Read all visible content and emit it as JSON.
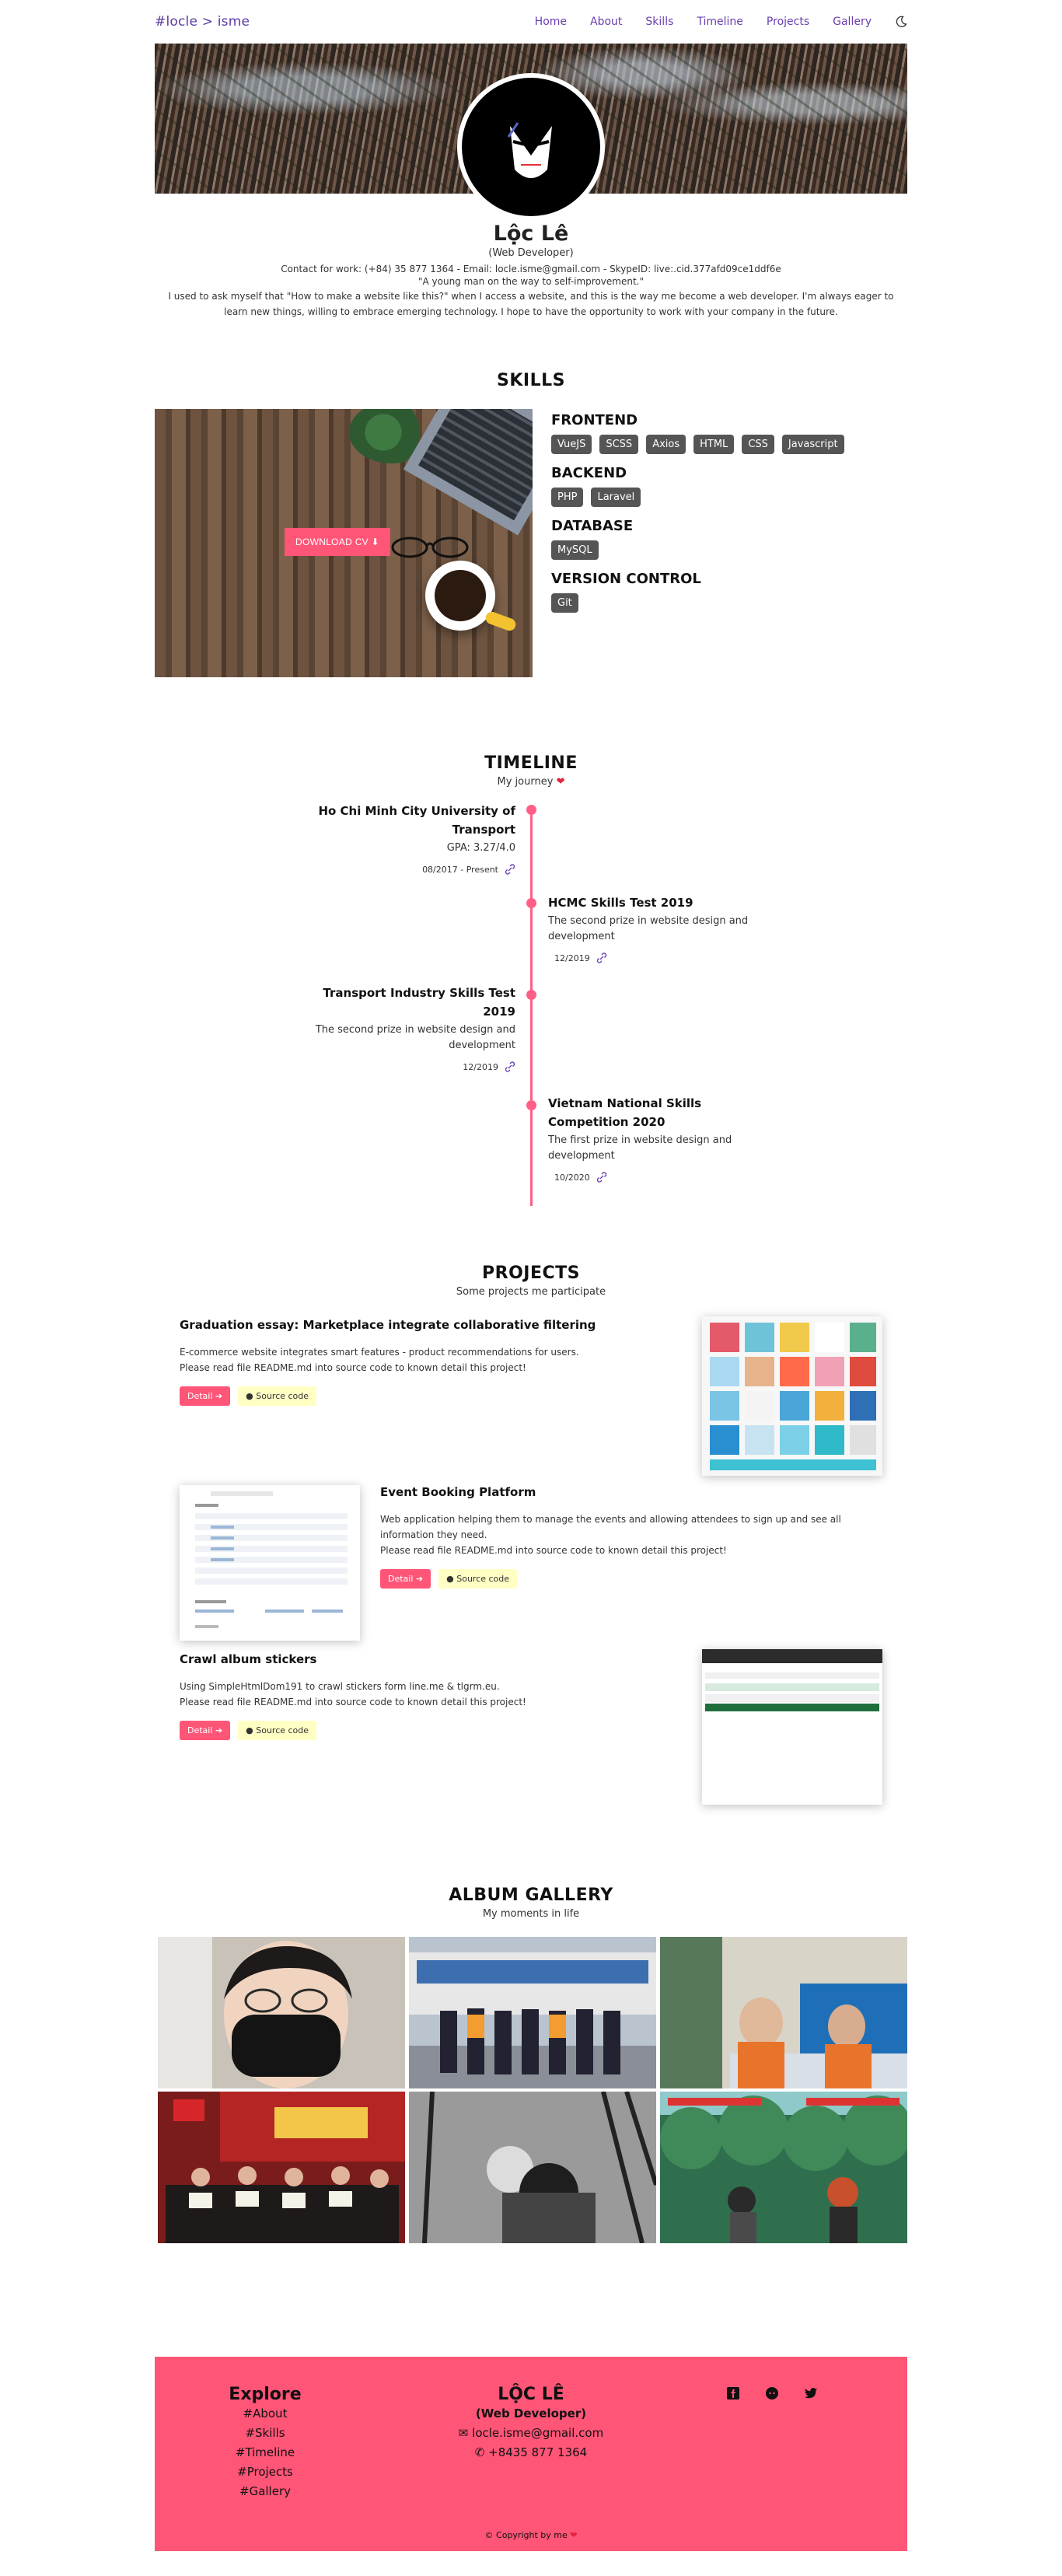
{
  "nav": {
    "brand": "#locle > isme",
    "links": [
      "Home",
      "About",
      "Skills",
      "Timeline",
      "Projects",
      "Gallery"
    ],
    "theme_icon": "moon-icon"
  },
  "profile": {
    "name": "Lộc Lê",
    "role": "(Web Developer)",
    "contact": "Contact for work: (+84) 35 877 1364 - Email: locle.isme@gmail.com - SkypeID: live:.cid.377afd09ce1ddf6e",
    "quote": "\"A young man on the way to self-improvement.\"",
    "bio": "I used to ask myself that \"How to make a website like this?\" when I access a website, and this is the way me become a web developer. I'm always eager to learn new things, willing to embrace emerging technology. I hope to have the opportunity to work with your company in the future."
  },
  "skills": {
    "title": "SKILLS",
    "cv_button": "DOWNLOAD CV",
    "groups": [
      {
        "name": "FRONTEND",
        "tags": [
          "VueJS",
          "SCSS",
          "Axios",
          "HTML",
          "CSS",
          "Javascript"
        ]
      },
      {
        "name": "BACKEND",
        "tags": [
          "PHP",
          "Laravel"
        ]
      },
      {
        "name": "DATABASE",
        "tags": [
          "MySQL"
        ]
      },
      {
        "name": "VERSION CONTROL",
        "tags": [
          "Git"
        ]
      }
    ]
  },
  "timeline": {
    "title": "TIMELINE",
    "subtitle": "My journey",
    "items": [
      {
        "title": "Ho Chi Minh City University of Transport",
        "desc": "GPA: 3.27/4.0",
        "date": "08/2017 - Present"
      },
      {
        "title": "HCMC Skills Test 2019",
        "desc": "The second prize in website design and development",
        "date": "12/2019"
      },
      {
        "title": "Transport Industry Skills Test 2019",
        "desc": "The second prize in website design and development",
        "date": "12/2019"
      },
      {
        "title": "Vietnam National Skills Competition 2020",
        "desc": "The first prize in website design and development",
        "date": "10/2020"
      }
    ]
  },
  "projects": {
    "title": "PROJECTS",
    "subtitle": "Some projects me participate",
    "detail_label": "Detail",
    "source_label": "Source code",
    "items": [
      {
        "title": "Graduation essay: Marketplace integrate collaborative filtering",
        "desc1": "E-commerce website integrates smart features - product recommendations for users.",
        "desc2": "Please read file README.md into source code to known detail this project!"
      },
      {
        "title": "Event Booking Platform",
        "desc1": "Web application helping them to manage the events and allowing attendees to sign up and see all information they need.",
        "desc2": "Please read file README.md into source code to known detail this project!"
      },
      {
        "title": "Crawl album stickers",
        "desc1": "Using SimpleHtmlDom191 to crawl stickers form line.me & tlgrm.eu.",
        "desc2": "Please read file README.md into source code to known detail this project!"
      }
    ]
  },
  "gallery": {
    "title": "ALBUM GALLERY",
    "subtitle": "My moments in life"
  },
  "footer": {
    "explore_title": "Explore",
    "explore_links": [
      "#About",
      "#Skills",
      "#Timeline",
      "#Projects",
      "#Gallery"
    ],
    "name": "LỘC LÊ",
    "role": "(Web Developer)",
    "email": "locle.isme@gmail.com",
    "phone": "+8435 877 1364",
    "copyright": "© Copyright by me",
    "social_icons": [
      "facebook-icon",
      "github-icon",
      "twitter-icon"
    ]
  },
  "colors": {
    "accent": "#ff5577",
    "nav_link": "#6a3fb0",
    "tag_bg": "#555555",
    "source_bg": "#ffffc4"
  }
}
